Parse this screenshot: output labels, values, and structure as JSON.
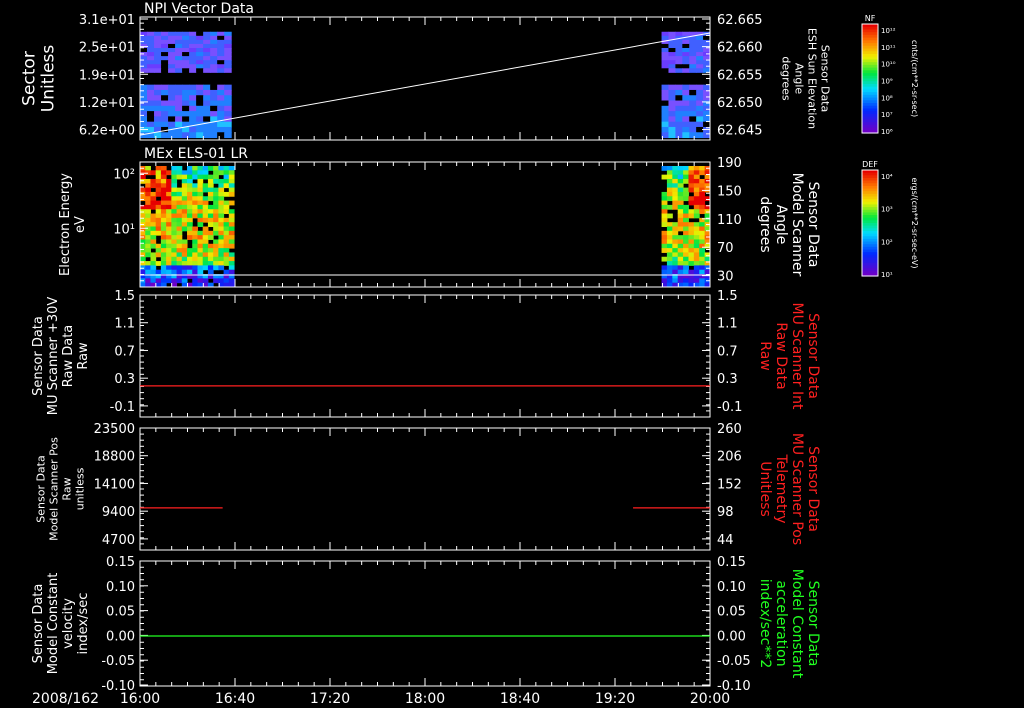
{
  "chart_data": {
    "type": "line",
    "date_label": "2008/162",
    "time_ticks": [
      "16:00",
      "16:40",
      "17:20",
      "18:00",
      "18:40",
      "19:20",
      "20:00"
    ],
    "panels": [
      {
        "id": "npi",
        "title": "NPI Vector Data",
        "kind": "spectrogram",
        "left_label": [
          "Sector",
          "Unitless"
        ],
        "left_ticks": [
          "3.1e+01",
          "2.5e+01",
          "1.9e+01",
          "1.2e+01",
          "6.2e+00"
        ],
        "right_label": [
          "Sensor Data",
          "ESH Sun Elevation",
          "Angle",
          "degrees"
        ],
        "right_ticks": [
          "62.665",
          "62.660",
          "62.655",
          "62.650",
          "62.645"
        ],
        "right_label_color": "#ffffff",
        "overlay_line": {
          "x": [
            0,
            1
          ],
          "y": [
            62.642,
            62.661
          ]
        },
        "colorbar": {
          "top_label": "NF",
          "unit": "cnts/(cm**2-sr-sec)",
          "ticks": [
            "10¹²",
            "10¹¹",
            "10¹⁰",
            "10⁹",
            "10⁸",
            "10⁷",
            "10⁶"
          ]
        }
      },
      {
        "id": "els",
        "title": "MEx ELS-01 LR",
        "kind": "spectrogram",
        "left_label": [
          "Electron Energy",
          "eV"
        ],
        "left_ticks": [
          "10²",
          "10¹"
        ],
        "right_label": [
          "Sensor Data",
          "Model Scanner",
          "Angle",
          "degrees"
        ],
        "right_ticks": [
          "190",
          "150",
          "110",
          "70",
          "30"
        ],
        "right_label_color": "#ffffff",
        "overlay_line": {
          "x": [
            0,
            1
          ],
          "y": [
            18,
            18
          ]
        },
        "colorbar": {
          "top_label": "DEF",
          "unit": "ergs/(cm**2-sr-sec-eV)",
          "ticks": [
            "10⁴",
            "10³",
            "10²",
            "10¹"
          ]
        }
      },
      {
        "id": "mu_raw",
        "title": "",
        "kind": "line",
        "left_label": [
          "Sensor Data",
          "MU Scanner +30V",
          "Raw Data",
          "Raw"
        ],
        "left_ticks": [
          "1.5",
          "1.1",
          "0.7",
          "0.3",
          "-0.1"
        ],
        "right_label": [
          "Sensor Data",
          "MU Scanner Int",
          "Raw Data",
          "Raw"
        ],
        "right_ticks": [
          "1.5",
          "1.1",
          "0.7",
          "0.3",
          "-0.1"
        ],
        "right_label_color": "#ff2020",
        "series": [
          {
            "color": "#ff2020",
            "segments": [
              {
                "t": [
                  0,
                  1
                ],
                "y": [
                  0.0,
                  0.0
                ]
              }
            ]
          }
        ],
        "ylim": [
          -0.3,
          1.5
        ]
      },
      {
        "id": "mu_pos",
        "title": "",
        "kind": "line",
        "left_label": [
          "Sensor Data",
          "Model Scanner Pos",
          "Raw",
          "unitless"
        ],
        "left_ticks": [
          "23500",
          "18800",
          "14100",
          "9400",
          "4700"
        ],
        "right_label": [
          "Sensor Data",
          "MU Scanner Pos",
          "Telemetry",
          "Unitless"
        ],
        "right_ticks": [
          "260",
          "206",
          "152",
          "98",
          "44"
        ],
        "right_label_color": "#ff2020",
        "series": [
          {
            "color": "#ff2020",
            "segments": [
              {
                "t": [
                  0,
                  0.145
                ],
                "y": [
                  8100,
                  8100
                ]
              },
              {
                "t": [
                  0.865,
                  1
                ],
                "y": [
                  8100,
                  8100
                ]
              }
            ]
          }
        ],
        "ylim": [
          0,
          23500
        ]
      },
      {
        "id": "const",
        "title": "",
        "kind": "line",
        "left_label": [
          "Sensor Data",
          "Model Constant",
          "velocity",
          "index/sec"
        ],
        "left_ticks": [
          "0.15",
          "0.10",
          "0.05",
          "0.00",
          "-0.05",
          "-0.10"
        ],
        "right_label": [
          "Sensor Data",
          "Model Constant",
          "acceleration",
          "index/sec**2"
        ],
        "right_ticks": [
          "0.15",
          "0.10",
          "0.05",
          "0.00",
          "-0.05",
          "-0.10"
        ],
        "right_label_color": "#20ff20",
        "series": [
          {
            "color": "#20ff20",
            "segments": [
              {
                "t": [
                  0,
                  1
                ],
                "y": [
                  0.0,
                  0.0
                ]
              }
            ]
          }
        ],
        "ylim": [
          -0.1,
          0.15
        ]
      }
    ]
  }
}
